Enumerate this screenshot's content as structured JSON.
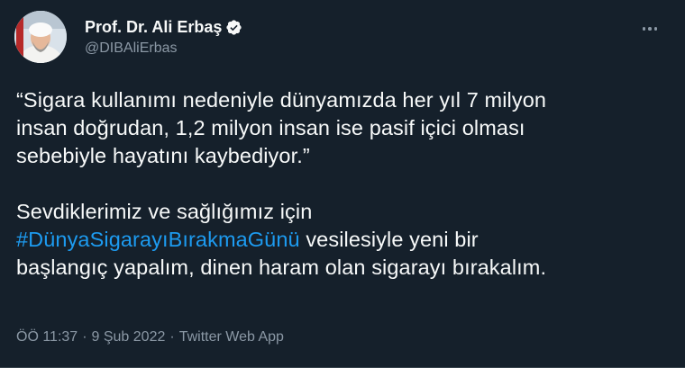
{
  "tweet": {
    "author": {
      "name": "Prof. Dr. Ali Erbaş",
      "handle": "@DIBAliErbas",
      "verified": true
    },
    "menu_icon": "more-horizontal-icon",
    "text": {
      "paragraph1": "“Sigara kullanımı nedeniyle dünyamızda her yıl 7 milyon\ninsan doğrudan, 1,2 milyon insan ise pasif içici olması\nsebebiyle hayatını kaybediyor.”",
      "paragraph2_before": "Sevdiklerimiz ve sağlığımız için\n",
      "hashtag": "#DünyaSigarayıBırakmaGünü",
      "paragraph2_after": " vesilesiyle yeni bir\nbaşlangıç yapalım, dinen haram olan sigarayı bırakalım."
    },
    "meta": {
      "time": "ÖÖ 11:37",
      "separator": "·",
      "date": "9 Şub 2022",
      "source": "Twitter Web App"
    },
    "colors": {
      "background": "#15202b",
      "text": "#f7f9f9",
      "secondary": "#8b98a5",
      "link": "#1d9bf0",
      "verified_badge": "#1d9bf0"
    }
  }
}
